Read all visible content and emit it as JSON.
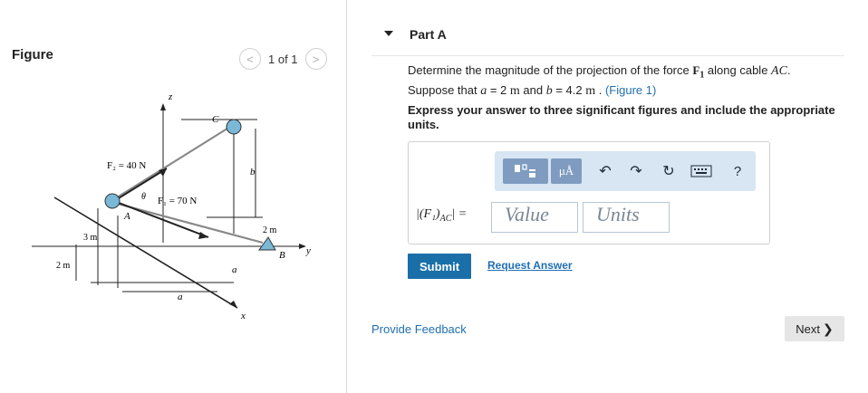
{
  "figure": {
    "title": "Figure",
    "pager": {
      "prev": "<",
      "text": "1 of 1",
      "next": ">"
    },
    "labels": {
      "z": "z",
      "C": "C",
      "F2": "F₂ = 40 N",
      "theta": "θ",
      "F1": "F₁ = 70 N",
      "A": "A",
      "b": "b",
      "dim3m": "3 m",
      "dim2m_left": "2 m",
      "dim2m_right": "2 m",
      "B": "B",
      "y": "y",
      "a_right": "a",
      "a_bottom": "a",
      "x": "x"
    }
  },
  "part": {
    "title": "Part A",
    "question": {
      "t1": "Determine the magnitude of the projection of the force ",
      "F": "F",
      "sub1": "1",
      "t2": " along cable ",
      "AC": "AC",
      "t3": ".",
      "t4": "Suppose that ",
      "a": "a",
      "t5": " = 2 ",
      "m1": "m",
      "t6": " and ",
      "b": "b",
      "t7": " = 4.2 ",
      "m2": "m",
      "t8": " . ",
      "link": "(Figure 1)"
    },
    "instructions": "Express your answer to three significant figures and include the appropriate units.",
    "answer": {
      "label_main": "|(F₁)",
      "label_sub": "AC",
      "label_end": "| =",
      "value_placeholder": "Value",
      "units_placeholder": "Units"
    },
    "toolbar": {
      "units_btn": "μÅ",
      "help": "?"
    },
    "submit": "Submit",
    "request_answer": "Request Answer"
  },
  "feedback": "Provide Feedback",
  "next": {
    "label": "Next",
    "chevron": "❯"
  }
}
